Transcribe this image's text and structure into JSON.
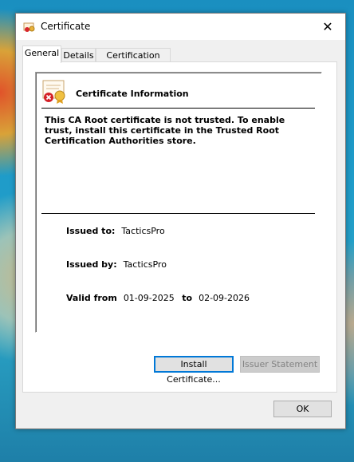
{
  "window": {
    "title": "Certificate",
    "close_glyph": "✕"
  },
  "tabs": [
    {
      "label": "General",
      "active": true
    },
    {
      "label": "Details",
      "active": false
    },
    {
      "label": "Certification Path",
      "active": false
    }
  ],
  "info": {
    "heading": "Certificate Information",
    "message": "This CA Root certificate is not trusted. To enable trust, install this certificate in the Trusted Root Certification Authorities store.",
    "issued_to_label": "Issued to:",
    "issued_to_value": "TacticsPro",
    "issued_by_label": "Issued by:",
    "issued_by_value": "TacticsPro",
    "valid_from_label": "Valid from",
    "valid_from_value": "01-09-2025",
    "valid_to_label": "to",
    "valid_to_value": "02-09-2026"
  },
  "buttons": {
    "install": "Install Certificate...",
    "issuer_statement": "Issuer Statement",
    "ok": "OK"
  },
  "icons": {
    "app": "certificate-icon",
    "cert": "untrusted-certificate-icon",
    "close": "close-icon"
  }
}
